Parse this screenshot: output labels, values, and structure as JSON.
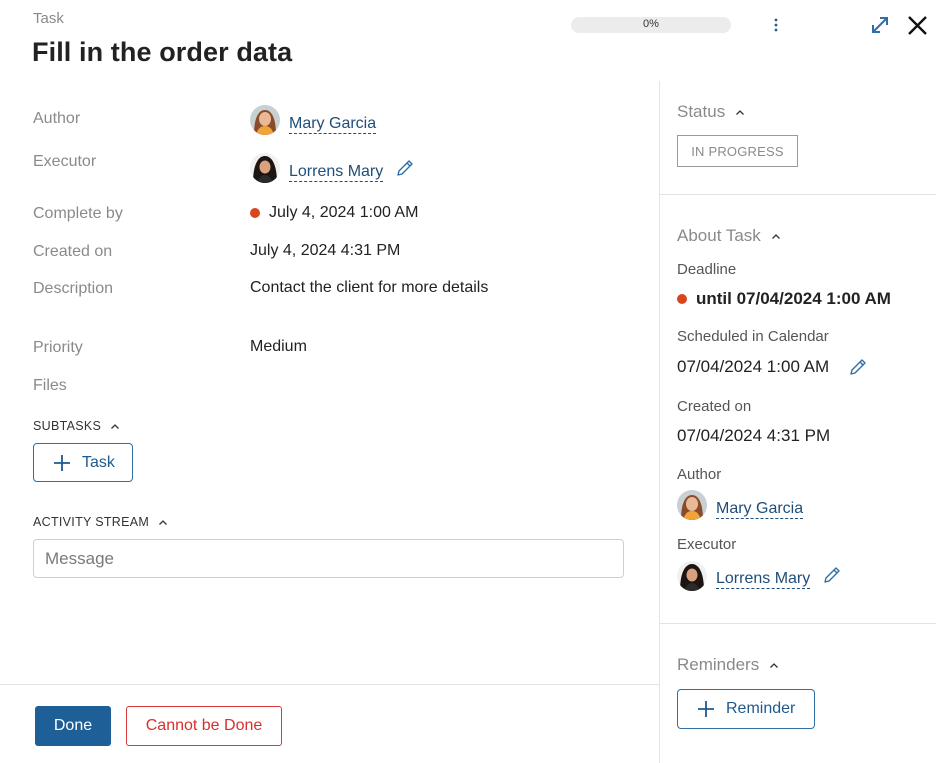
{
  "header": {
    "kicker": "Task",
    "title": "Fill in the order data",
    "progress_label": "0%",
    "progress_value": 0
  },
  "fields": {
    "author_label": "Author",
    "author_name": "Mary Garcia",
    "executor_label": "Executor",
    "executor_name": "Lorrens Mary",
    "complete_by_label": "Complete by",
    "complete_by_value": "July 4, 2024 1:00 AM",
    "created_on_label": "Created on",
    "created_on_value": "July 4, 2024 4:31 PM",
    "description_label": "Description",
    "description_value": "Contact the client for more details",
    "priority_label": "Priority",
    "priority_value": "Medium",
    "files_label": "Files"
  },
  "subtasks": {
    "title": "SUBTASKS",
    "add_label": "Task"
  },
  "activity": {
    "title": "ACTIVITY STREAM",
    "message_placeholder": "Message"
  },
  "footer": {
    "done_label": "Done",
    "cannot_label": "Cannot be Done"
  },
  "sidebar": {
    "status_title": "Status",
    "status_value": "IN PROGRESS",
    "about_title": "About Task",
    "deadline_label": "Deadline",
    "deadline_value": "until 07/04/2024 1:00 AM",
    "scheduled_label": "Scheduled in Calendar",
    "scheduled_value": "07/04/2024 1:00 AM",
    "created_label": "Created on",
    "created_value": "07/04/2024 4:31 PM",
    "author_label": "Author",
    "author_name": "Mary Garcia",
    "executor_label": "Executor",
    "executor_name": "Lorrens Mary",
    "reminders_title": "Reminders",
    "reminder_add_label": "Reminder"
  },
  "colors": {
    "primary": "#1f5f98",
    "link": "#1f4e79",
    "danger": "#d82f2f",
    "overdue_dot": "#d9461e"
  }
}
